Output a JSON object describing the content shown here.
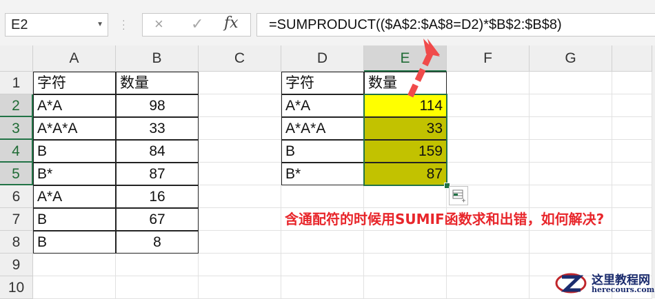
{
  "name_box": {
    "value": "E2"
  },
  "formula_bar": {
    "cancel_icon": "×",
    "enter_icon": "✓",
    "fx_label": "fx",
    "formula": "=SUMPRODUCT(($A$2:$A$8=D2)*$B$2:$B$8)"
  },
  "columns": [
    "A",
    "B",
    "C",
    "D",
    "E",
    "F",
    "G"
  ],
  "rows": [
    "1",
    "2",
    "3",
    "4",
    "5",
    "6",
    "7",
    "8",
    "9",
    "10"
  ],
  "table1": {
    "headers": [
      "字符",
      "数量"
    ],
    "rows": [
      [
        "A*A",
        "98"
      ],
      [
        "A*A*A",
        "33"
      ],
      [
        "B",
        "84"
      ],
      [
        "B*",
        "87"
      ],
      [
        "A*A",
        "16"
      ],
      [
        "B",
        "67"
      ],
      [
        "B",
        "8"
      ]
    ]
  },
  "table2": {
    "headers": [
      "字符",
      "数量"
    ],
    "rows": [
      [
        "A*A",
        "114"
      ],
      [
        "A*A*A",
        "33"
      ],
      [
        "B",
        "159"
      ],
      [
        "B*",
        "87"
      ]
    ]
  },
  "annotation": "含通配符的时候用SUMIF函数求和出错，如何解决?",
  "watermark": {
    "name": "这里教程网",
    "url": "herecours.com"
  },
  "colors": {
    "selection": "#217346",
    "highlight_yellow": "#ffff00",
    "highlight_olive": "#c2c200",
    "annotation_red": "#e8262b"
  }
}
